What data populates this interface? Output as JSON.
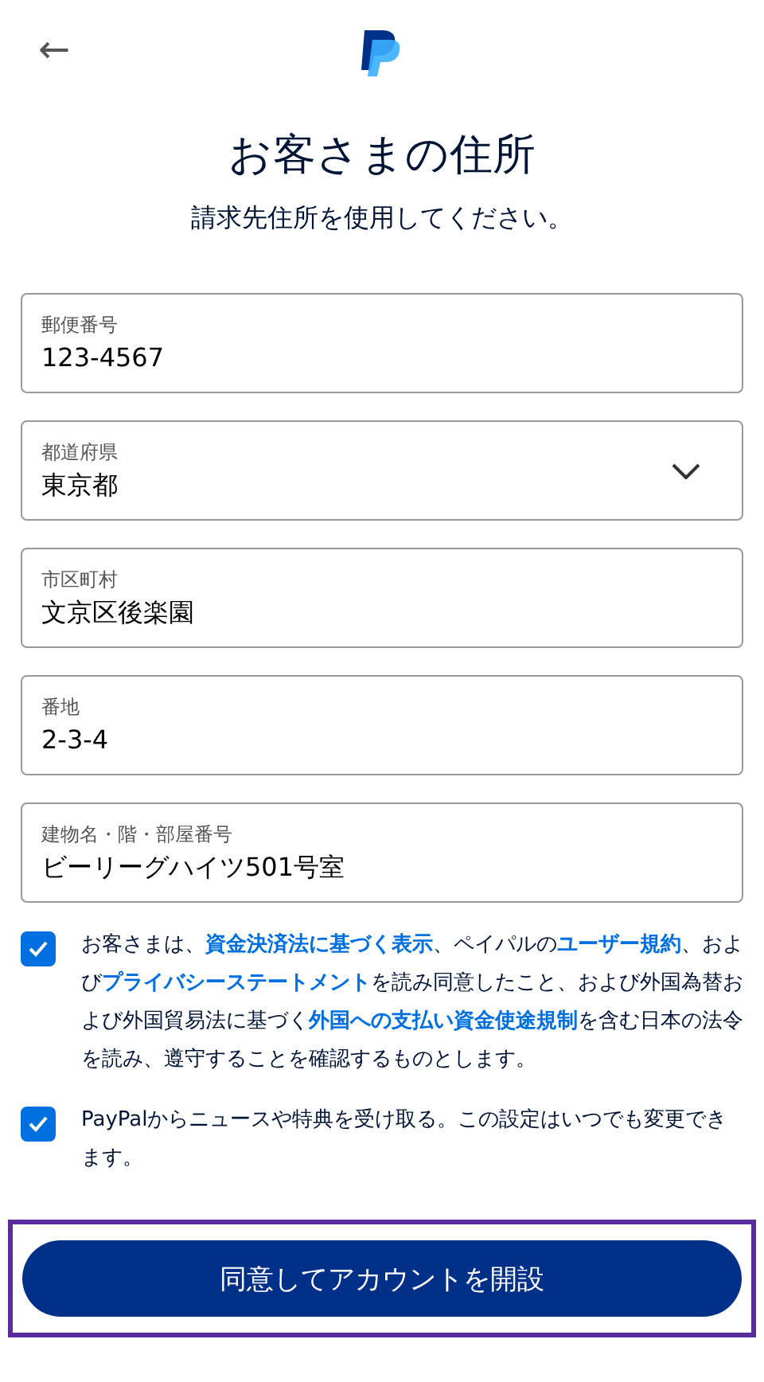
{
  "header": {
    "back_icon": "←"
  },
  "title": "お客さまの住所",
  "subtitle": "請求先住所を使用してください。",
  "fields": [
    {
      "kind": "text",
      "label": "郵便番号",
      "value": "123-4567"
    },
    {
      "kind": "select",
      "label": "都道府県",
      "value": "東京都"
    },
    {
      "kind": "text",
      "label": "市区町村",
      "value": "文京区後楽園"
    },
    {
      "kind": "text",
      "label": "番地",
      "value": "2-3-4"
    },
    {
      "kind": "text",
      "label": "建物名・階・部屋番号",
      "value": "ビーリーグハイツ501号室"
    }
  ],
  "agreements": [
    {
      "checked": true,
      "segments": [
        {
          "text": "お客さまは、",
          "link": false
        },
        {
          "text": "資金決済法に基づく表示",
          "link": true
        },
        {
          "text": "、ペイパルの",
          "link": false
        },
        {
          "text": "ユーザー規約",
          "link": true
        },
        {
          "text": "、および",
          "link": false
        },
        {
          "text": "プライバシーステートメント",
          "link": true
        },
        {
          "text": "を読み同意したこと、および外国為替および外国貿易法に基づく",
          "link": false
        },
        {
          "text": "外国への支払い資金使途規制",
          "link": true
        },
        {
          "text": "を含む日本の法令を読み、遵守することを確認するものとします。",
          "link": false
        }
      ]
    },
    {
      "checked": true,
      "segments": [
        {
          "text": "PayPalからニュースや特典を受け取る。この設定はいつでも変更できます。",
          "link": false
        }
      ]
    }
  ],
  "submit": {
    "label": "同意してアカウントを開設",
    "focused": true
  }
}
